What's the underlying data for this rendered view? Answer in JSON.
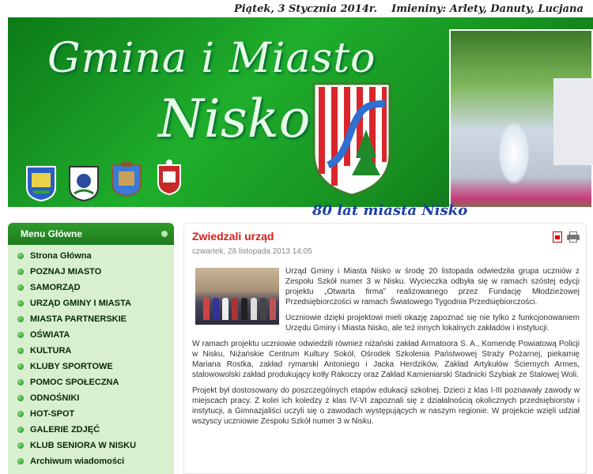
{
  "topbar": {
    "date": "Piątek, 3 Stycznia  2014r.",
    "nameday_label": "Imieniny:",
    "names": "Arlety, Danuty, Lucjana"
  },
  "header": {
    "title_line1": "Gmina i Miasto",
    "title_line2": "Nisko",
    "anniversary": "80 lat miasta Nisko"
  },
  "colors": {
    "header_green": "#1fae2c",
    "menu_bg": "#d8efd0",
    "menu_head": "#2f9c2b",
    "article_title": "#d4201a",
    "anniversary_text": "#1e3ea8"
  },
  "sidebar": {
    "heading": "Menu Główne",
    "items": [
      {
        "label": "Strona Główna"
      },
      {
        "label": "POZNAJ MIASTO"
      },
      {
        "label": "SAMORZĄD"
      },
      {
        "label": "URZĄD GMINY I MIASTA"
      },
      {
        "label": "MIASTA PARTNERSKIE"
      },
      {
        "label": "OŚWIATA"
      },
      {
        "label": "KULTURA"
      },
      {
        "label": "KLUBY SPORTOWE"
      },
      {
        "label": "POMOC SPOŁECZNA"
      },
      {
        "label": "ODNOŚNIKI"
      },
      {
        "label": "HOT-SPOT"
      },
      {
        "label": "GALERIE ZDJĘĆ"
      },
      {
        "label": "KLUB SENIORA W NISKU"
      },
      {
        "label": "Archiwum wiadomości"
      }
    ]
  },
  "article": {
    "title": "Zwiedzali urząd",
    "date": "czwartek, 28 listopada 2013 14:05",
    "icons": [
      "pdf-icon",
      "print-icon"
    ],
    "paragraphs": [
      "Urząd Gminy i Miasta Nisko w środę 20 listopada odwiedziła grupa uczniów z Zespołu Szkół numer 3 w Nisku. Wycieczka odbyła się w ramach szóstej edycji projektu „Otwarta firma” realizowanego przez Fundację Młodzieżowej Przedsiębiorczości w ramach Światowego Tygodnia Przedsiębiorczości.",
      "Uczniowie dzięki projektowi mieli okazję zapoznać się nie tylko z funkcjonowaniem Urzędu Gminy i Miasta Nisko, ale też innych lokalnych zakładów i instytucji.",
      "W ramach projektu uczniowie odwiedzili również niżański zakład Armatoora S. A., Komendę Powiatową Policji w Nisku, Niżańskie Centrum Kultury Sokół, Ośrodek Szkolenia Państwowej Straży Pożarnej, piekarnię Mariana Rostka, zakład rymarski Antoniego i Jacka Herdzików, Zakład Artykułów Ściernych Armes, stalowowolski zakład produkujący kotły Rakoczy oraz Zakład Kamieniarski Stadnicki Szybiak ze Stalowej Woli.",
      "Projekt był dostosowany do poszczególnych etapów edukacji szkolnej. Dzieci z klas I-III poznawały zawody w miejscach pracy. Z kolei ich koledzy z klas IV-VI zapoznali się z działalnością okolicznych przedsiębiorstw i instytucji, a Gimnazjaliści uczyli się o zawodach występujących w naszym regionie. W projekcie wzięli udział wszyscy uczniowie Zespołu Szkół numer 3 w Nisku."
    ]
  }
}
